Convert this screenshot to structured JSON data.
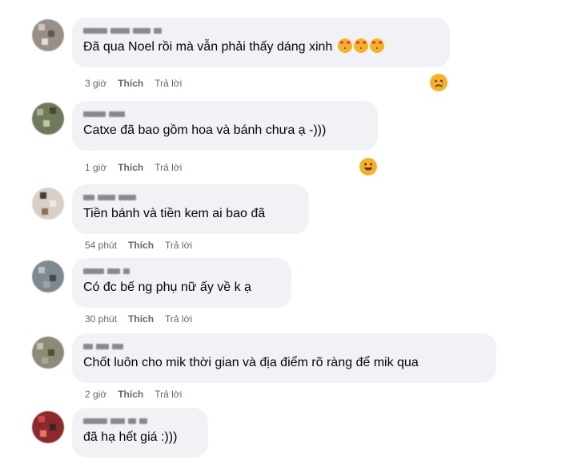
{
  "comments": [
    {
      "text": "Đã qua Noel rồi mà vẫn phải thấy dáng xinh",
      "inline_emoji": "smiling-face-with-hearts-icon",
      "time": "3 giờ",
      "like": "Thích",
      "reply": "Trả lời",
      "reaction": "crying-face-icon"
    },
    {
      "text": "Catxe đã bao gồm hoa và bánh chưa ạ -)))",
      "time": "1 giờ",
      "like": "Thích",
      "reply": "Trả lời",
      "reaction": "grinning-face-icon"
    },
    {
      "text": "Tiền bánh và tiền kem ai bao đã",
      "time": "54 phút",
      "like": "Thích",
      "reply": "Trả lời"
    },
    {
      "text": "Có đc bế ng phụ nữ ấy về k ạ",
      "time": "30 phút",
      "like": "Thích",
      "reply": "Trả lời"
    },
    {
      "text": "Chốt luôn cho mik thời gian và địa điểm rõ ràng để mik qua",
      "time": "2 giờ",
      "like": "Thích",
      "reply": "Trả lời"
    },
    {
      "text": "đã hạ hết giá :)))"
    }
  ],
  "colors": {
    "bubble": "#f0f2f5",
    "meta": "#65676b",
    "text": "#050505",
    "emoji": "#f7b125"
  }
}
